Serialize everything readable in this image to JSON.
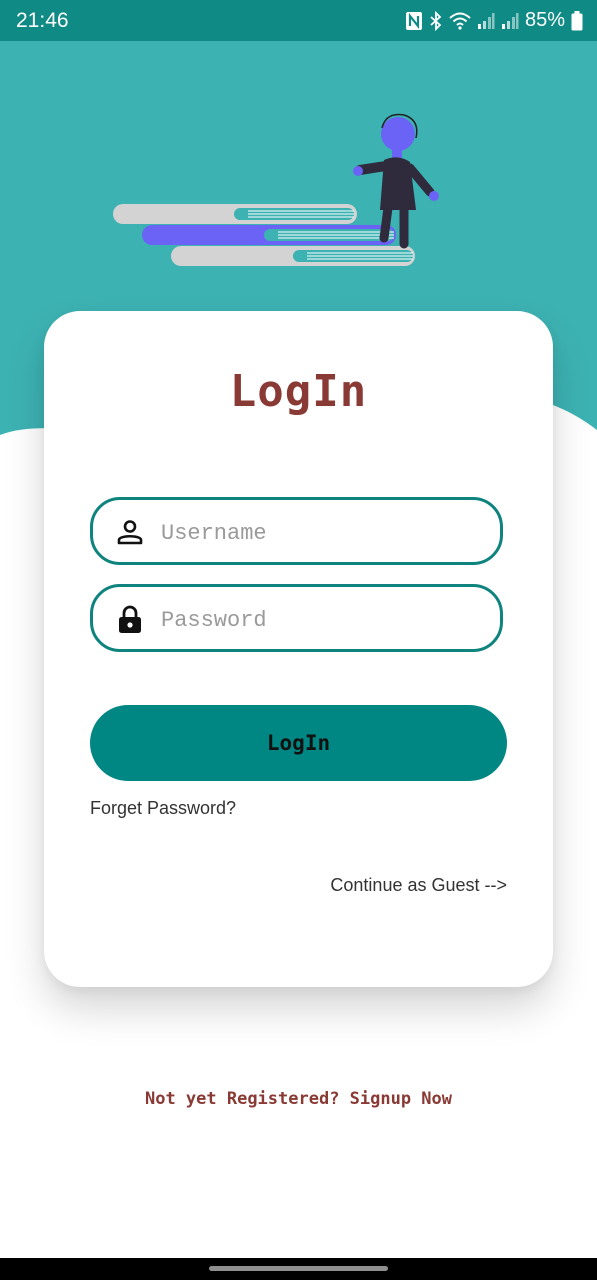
{
  "status_bar": {
    "time": "21:46",
    "battery_percent": "85%",
    "icons": [
      "nfc-icon",
      "bluetooth-icon",
      "wifi-icon",
      "signal-icon",
      "signal-icon",
      "battery-icon"
    ]
  },
  "colors": {
    "primary_teal": "#008784",
    "header_teal": "#3db2b3",
    "title_red": "#8a3a35"
  },
  "illustration": {
    "name": "person-walking-up-books-illustration"
  },
  "login_card": {
    "title": "LogIn",
    "username_placeholder": "Username",
    "password_placeholder": "Password",
    "username_icon": "person-icon",
    "password_icon": "lock-icon",
    "login_button": "LogIn",
    "forget_password": "Forget Password?",
    "continue_guest": "Continue as Guest -->"
  },
  "signup_link": "Not yet Registered? Signup Now"
}
